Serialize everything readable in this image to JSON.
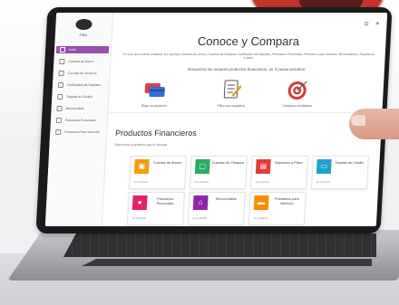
{
  "app": {
    "logo_text": "Fitko"
  },
  "topbar": {
    "icon1": "⊡",
    "icon2": "☀"
  },
  "sidebar": {
    "items": [
      {
        "label": "Inicio",
        "icon": "home-icon",
        "active": true
      },
      {
        "label": "Cuentas de Ahorro",
        "icon": "piggy-bank-icon"
      },
      {
        "label": "Cuentas de Cheques",
        "icon": "check-icon"
      },
      {
        "label": "Certificados de Depósito",
        "icon": "certificate-icon"
      },
      {
        "label": "Tarjetas de Crédito",
        "icon": "card-icon"
      },
      {
        "label": "Microcréditos",
        "icon": "microcredit-icon"
      },
      {
        "label": "Préstamos Personales",
        "icon": "loan-icon"
      },
      {
        "label": "Préstamos Para Vehículo",
        "icon": "car-icon"
      }
    ]
  },
  "main": {
    "title": "Conoce y Compara",
    "description": "En este sitio podrás comparar, por ejemplo, Cuentas de Ahorro, Cuentas de Cheques, Certificados de Depósito, Préstamos Personales, Préstamos para Vehículo, Microcréditos y Tarjetas de Crédito.",
    "subtitle": "Encuentra los mejores productos financieros, en 3 pasos sencillos:",
    "steps": [
      {
        "label": "Elige un producto",
        "icon": "card-icon"
      },
      {
        "label": "Filtra tus requisitos",
        "icon": "checklist-icon"
      },
      {
        "label": "Compara resultados",
        "icon": "target-icon"
      }
    ]
  },
  "products": {
    "title": "Productos Financieros",
    "subtitle": "Selecciona el producto que te interesa",
    "items": [
      {
        "label": "Cuentas de Ahorro",
        "color": "#f39c12",
        "icon": "📋",
        "footer": "Ver producto"
      },
      {
        "label": "Cuentas de Cheques",
        "color": "#27ae60",
        "icon": "▢",
        "footer": "Ver producto"
      },
      {
        "label": "Depósitos a Plazo",
        "color": "#e53935",
        "icon": "🗎",
        "footer": "Ver producto"
      },
      {
        "label": "Tarjetas de Crédito",
        "color": "#1fa2c9",
        "icon": "▭",
        "footer": "Ver producto"
      },
      {
        "label": "Préstamos Personales",
        "color": "#e91e63",
        "icon": "👤",
        "footer": "Ver producto"
      },
      {
        "label": "Microcréditos",
        "color": "#8e24aa",
        "icon": "⌂",
        "footer": "Ver producto"
      },
      {
        "label": "Préstamos para Vehículo",
        "color": "#fb8c00",
        "icon": "🚗",
        "footer": "Ver producto"
      }
    ]
  }
}
